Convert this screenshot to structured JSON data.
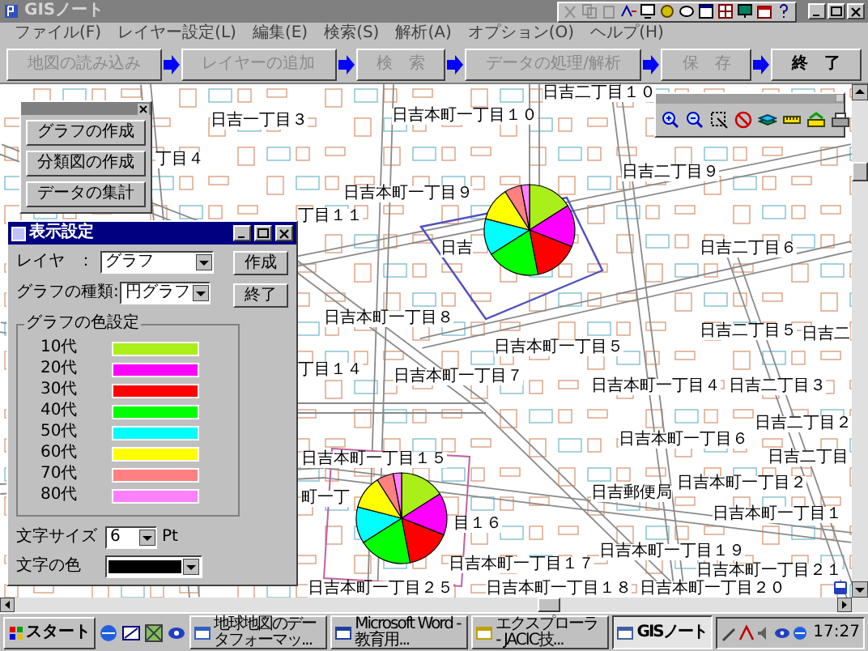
{
  "window": {
    "title": "GISノート"
  },
  "menu": [
    "ファイル(F)",
    "レイヤー設定(L)",
    "編集(E)",
    "検索(S)",
    "解析(A)",
    "オプション(O)",
    "ヘルプ(H)"
  ],
  "steps": [
    {
      "label": "地図の読み込み",
      "disabled": true
    },
    {
      "label": "レイヤーの追加",
      "disabled": true
    },
    {
      "label": "検　索",
      "disabled": true
    },
    {
      "label": "データの処理/解析",
      "disabled": true
    },
    {
      "label": "保　存",
      "disabled": true
    },
    {
      "label": "終　了",
      "disabled": false
    }
  ],
  "tool_palette": {
    "buttons": [
      "グラフの作成",
      "分類図の作成",
      "データの集計"
    ]
  },
  "map": {
    "labels": [
      "日吉二丁目１０",
      "日吉一丁目３",
      "日吉本町一丁目１０",
      "丁目４",
      "日吉二丁目９",
      "日吉本町一丁目９",
      "丁目１１",
      "日吉",
      "日吉二丁目６",
      "日吉本町一丁目８",
      "日吉二丁目５",
      "日吉二",
      "日吉本町一丁目５",
      "丁目１４",
      "日吉本町一丁目７",
      "日吉本町一丁目４",
      "日吉二丁目３",
      "日吉本町一丁目６",
      "日吉二丁目２",
      "日吉二丁目",
      "日吉本町一丁目１５",
      "日吉郵便局",
      "日吉本町一丁目２",
      "町一丁",
      "日吉本町一丁目１",
      "目１６",
      "日吉本町一丁目１７",
      "日吉本町一丁目１９",
      "日吉本町一丁目２１",
      "日吉本町一丁目２５",
      "日吉本町一丁目１８",
      "日吉本町一丁目２０"
    ]
  },
  "dialog": {
    "title": "表示設定",
    "layer": {
      "label": "レイヤ",
      "separator": "：",
      "value": "グラフ"
    },
    "graph_type": {
      "label": "グラフの種類:",
      "value": "円グラフ"
    },
    "buttons": [
      "作成",
      "終了"
    ],
    "color_group": {
      "title": "グラフの色設定",
      "items": [
        {
          "label": "10代",
          "color": "#aaee1a"
        },
        {
          "label": "20代",
          "color": "#ff00ff"
        },
        {
          "label": "30代",
          "color": "#ff0000"
        },
        {
          "label": "40代",
          "color": "#00ff00"
        },
        {
          "label": "50代",
          "color": "#00ffff"
        },
        {
          "label": "60代",
          "color": "#ffff00"
        },
        {
          "label": "70代",
          "color": "#ff8080"
        },
        {
          "label": "80代",
          "color": "#ff80ff"
        }
      ]
    },
    "font_size": {
      "label": "文字サイズ",
      "value": "6",
      "unit": "Pt"
    },
    "font_color": {
      "label": "文字の色",
      "color": "#000000"
    }
  },
  "taskbar": {
    "start": "スタート",
    "tasks": [
      {
        "label": "地球地図のデータフォーマッ...",
        "selected": false
      },
      {
        "label": "Microsoft Word - 教育用...",
        "selected": false
      },
      {
        "label": "エクスプローラ - JACIC技...",
        "selected": false
      },
      {
        "label": "GISノート",
        "selected": true
      }
    ],
    "clock": "17:27"
  }
}
